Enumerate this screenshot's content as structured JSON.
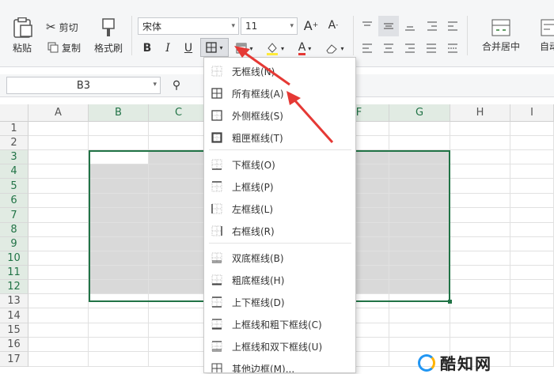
{
  "ribbon": {
    "paste": "粘贴",
    "cut": "剪切",
    "copy": "复制",
    "format_painter": "格式刷",
    "font_name": "宋体",
    "font_size": "11",
    "bold": "B",
    "italic": "I",
    "underline": "U",
    "font_color_letter": "A",
    "increase_font": "A",
    "decrease_font": "A",
    "merge_center": "合并居中",
    "autowrap": "自动"
  },
  "formula_bar": {
    "name_box": "B3"
  },
  "sheet": {
    "columns": [
      "A",
      "B",
      "C",
      "D",
      "E",
      "F",
      "G",
      "H",
      "I"
    ],
    "rows": [
      "1",
      "2",
      "3",
      "4",
      "5",
      "6",
      "7",
      "8",
      "9",
      "10",
      "11",
      "12",
      "13",
      "14",
      "15",
      "16",
      "17"
    ]
  },
  "border_menu": {
    "items": [
      {
        "label": "无框线(N)",
        "icon": "no-border-icon"
      },
      {
        "label": "所有框线(A)",
        "icon": "all-borders-icon"
      },
      {
        "label": "外侧框线(S)",
        "icon": "outside-borders-icon"
      },
      {
        "label": "粗匣框线(T)",
        "icon": "thick-box-border-icon"
      },
      {
        "label": "下框线(O)",
        "icon": "bottom-border-icon"
      },
      {
        "label": "上框线(P)",
        "icon": "top-border-icon"
      },
      {
        "label": "左框线(L)",
        "icon": "left-border-icon"
      },
      {
        "label": "右框线(R)",
        "icon": "right-border-icon"
      },
      {
        "label": "双底框线(B)",
        "icon": "double-bottom-border-icon"
      },
      {
        "label": "粗底框线(H)",
        "icon": "thick-bottom-border-icon"
      },
      {
        "label": "上下框线(D)",
        "icon": "top-bottom-border-icon"
      },
      {
        "label": "上框线和粗下框线(C)",
        "icon": "top-thick-bottom-border-icon"
      },
      {
        "label": "上框线和双下框线(U)",
        "icon": "top-double-bottom-border-icon"
      },
      {
        "label": "其他边框(M)...",
        "icon": "more-borders-icon"
      }
    ]
  },
  "watermark": "酷知网",
  "colors": {
    "selection_border": "#217346",
    "selection_fill": "#d9d9d9",
    "arrow": "#e53935"
  }
}
